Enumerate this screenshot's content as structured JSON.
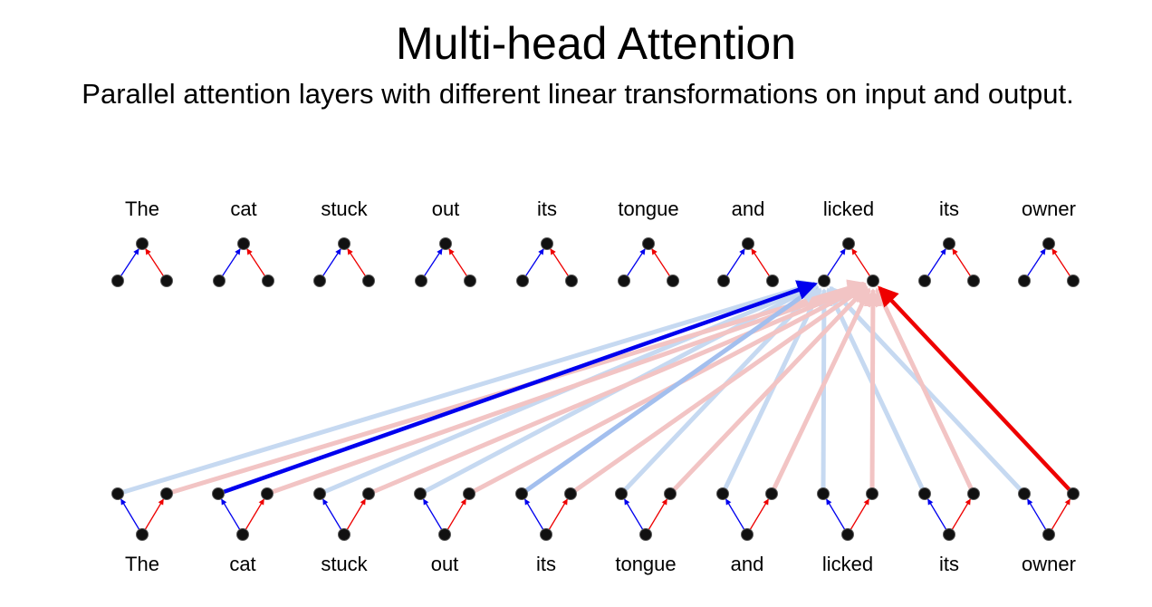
{
  "title": "Multi-head Attention",
  "subtitle": "Parallel attention layers with different linear transformations on input and output.",
  "tokens": [
    "The",
    "cat",
    "stuck",
    "out",
    "its",
    "tongue",
    "and",
    "licked",
    "its",
    "owner"
  ],
  "colors": {
    "head_blue": "#0000ee",
    "head_red": "#ee0000",
    "node": "#111111",
    "blue_strong": "#0000ee",
    "red_strong": "#ee0000",
    "blue_faint": "#c6d9f1",
    "red_faint": "#f2c4c4",
    "blue_medium": "#a3bfee"
  },
  "attention": {
    "query_token": "licked",
    "blue_head": {
      "strong": "cat",
      "medium": [
        "its"
      ],
      "faint": [
        "The",
        "stuck",
        "out",
        "tongue",
        "and",
        "licked",
        "its",
        "owner"
      ]
    },
    "red_head": {
      "strong": "owner",
      "faint": [
        "The",
        "cat",
        "stuck",
        "out",
        "its",
        "tongue",
        "and",
        "licked",
        "its"
      ]
    }
  }
}
